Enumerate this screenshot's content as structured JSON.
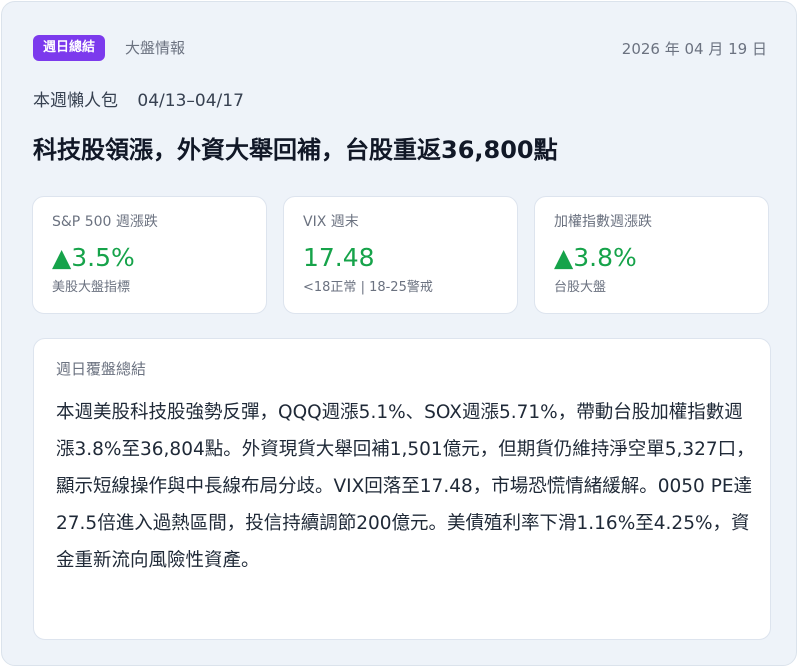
{
  "header": {
    "badge": "週日總結",
    "category": "大盤情報",
    "date": "2026 年 04 月 19 日"
  },
  "digest": {
    "label": "本週懶人包",
    "range": "04/13–04/17"
  },
  "headline": "科技股領漲，外資大舉回補，台股重返36,800點",
  "metrics": [
    {
      "label": "S&P 500 週漲跌",
      "value": "▲3.5%",
      "sub": "美股大盤指標"
    },
    {
      "label": "VIX 週末",
      "value": "17.48",
      "sub": "<18正常 | 18-25警戒"
    },
    {
      "label": "加權指數週漲跌",
      "value": "▲3.8%",
      "sub": "台股大盤"
    }
  ],
  "summary": {
    "label": "週日覆盤總結",
    "body": "本週美股科技股強勢反彈，QQQ週漲5.1%、SOX週漲5.71%，帶動台股加權指數週漲3.8%至36,804點。外資現貨大舉回補1,501億元，但期貨仍維持淨空單5,327口，顯示短線操作與中長線布局分歧。VIX回落至17.48，市場恐慌情緒緩解。0050 PE達27.5倍進入過熱區間，投信持續調節200億元。美債殖利率下滑1.16%至4.25%，資金重新流向風險性資產。"
  },
  "colors": {
    "badge": "#7c3aed",
    "positive": "#16a34a"
  }
}
